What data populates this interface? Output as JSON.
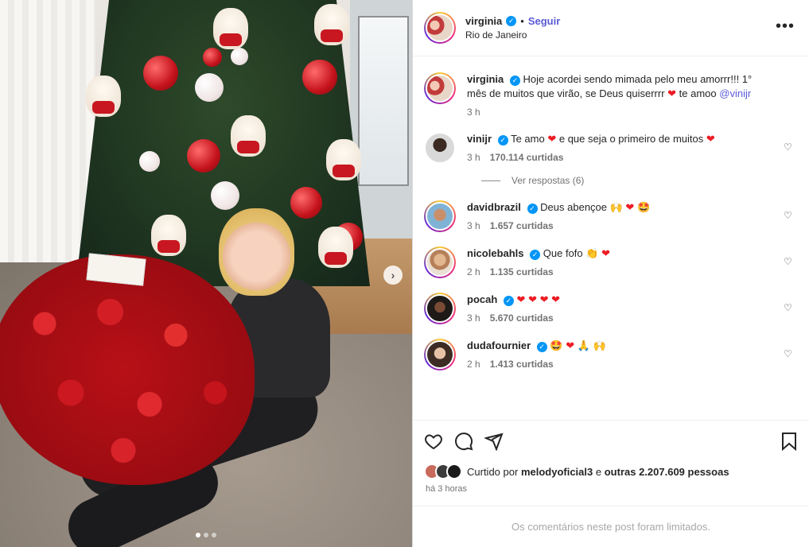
{
  "post": {
    "username": "virginia",
    "follow_label": "Seguir",
    "separator": "•",
    "location": "Rio de Janeiro",
    "more_label": "•••",
    "photo_count": 3,
    "photo_index": 1
  },
  "caption": {
    "username": "virginia",
    "text": "Hoje acordei sendo mimada pelo meu amorrr!!! 1° mês de muitos que virão, se Deus quiserrrr ❤️ te amoo ",
    "mention": "@vinijr",
    "time": "3 h"
  },
  "comments": [
    {
      "username": "vinijr",
      "text": "Te amo ❤️ e que seja o primeiro de muitos ❤️",
      "time": "3 h",
      "likes": "170.114 curtidas"
    },
    {
      "username": "davidbrazil",
      "text": "Deus abençoe 🙌 ❤️ 🤩",
      "time": "3 h",
      "likes": "1.657 curtidas"
    },
    {
      "username": "nicolebahls",
      "text": "Que fofo 👏 ❤️",
      "time": "2 h",
      "likes": "1.135 curtidas"
    },
    {
      "username": "pocah",
      "text": "❤️ ❤️ ❤️ ❤️",
      "time": "3 h",
      "likes": "5.670 curtidas"
    },
    {
      "username": "dudafournier",
      "text": "🤩 ❤️ 🙏 🙌",
      "time": "2 h",
      "likes": "1.413 curtidas"
    }
  ],
  "replies": {
    "label": "Ver respostas (6)"
  },
  "likes": {
    "prefix": "Curtido por",
    "user": "melodyoficial3",
    "middle": "e",
    "others": "outras 2.207.609 pessoas",
    "ago": "há 3 horas"
  },
  "footer": {
    "limited": "Os comentários neste post foram limitados."
  },
  "icons": {
    "like": "heart-icon",
    "comment": "comment-icon",
    "share": "share-icon",
    "save": "bookmark-icon",
    "verified": "verified-badge-icon",
    "more": "more-options-icon",
    "next": "chevron-right-icon"
  },
  "colors": {
    "link": "#5a5ad8",
    "verified": "#0095f6",
    "muted": "#737373",
    "heart": "#ed1c24"
  }
}
